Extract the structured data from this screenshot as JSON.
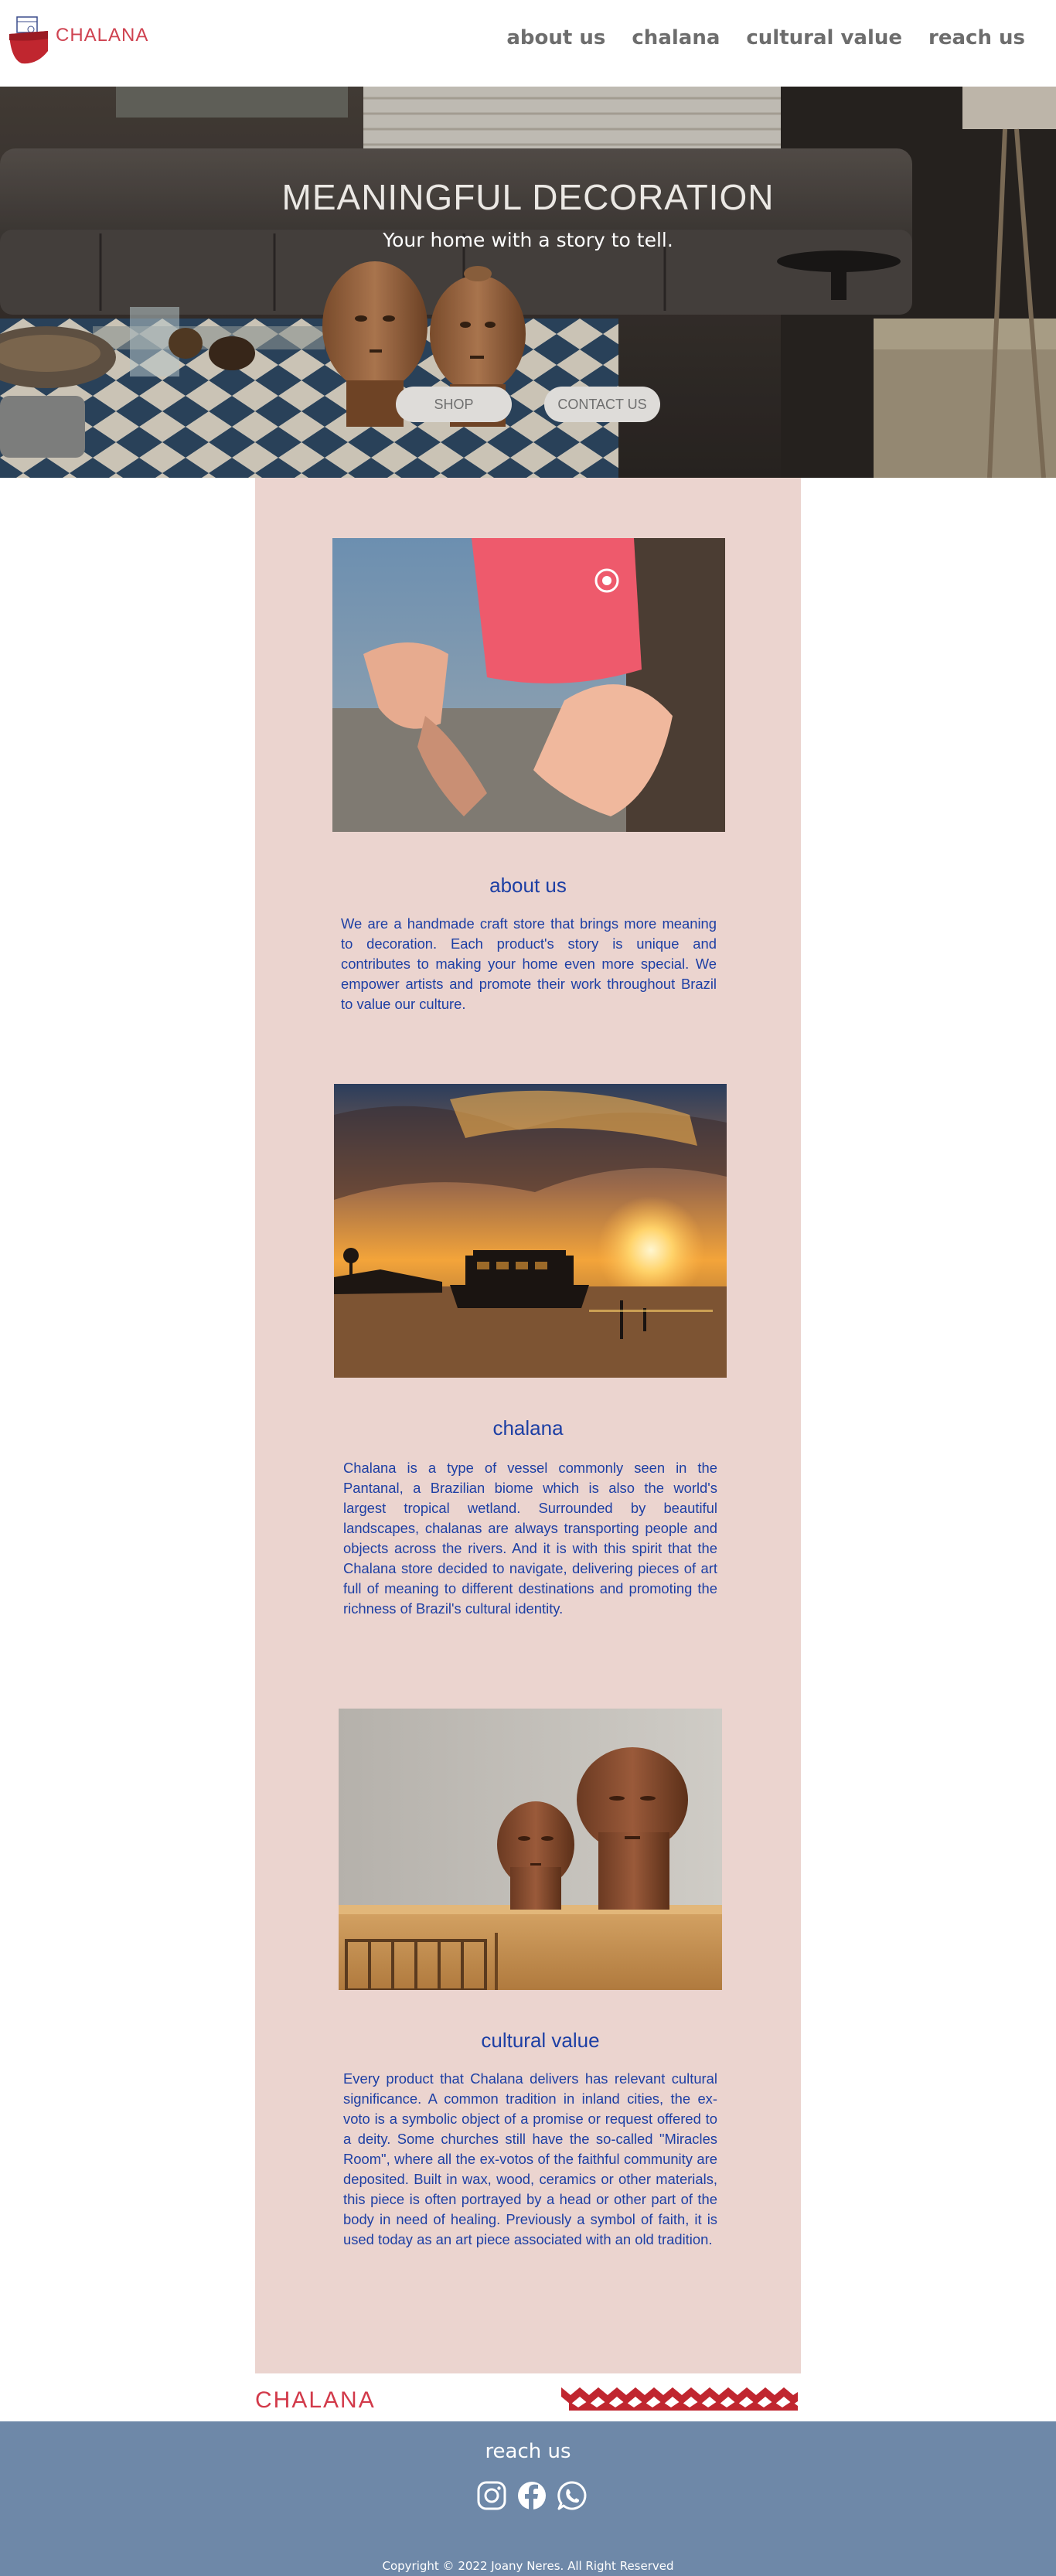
{
  "header": {
    "logo_text": "CHALANA",
    "nav": [
      "about us",
      "chalana",
      "cultural value",
      "reach us"
    ]
  },
  "hero": {
    "title": "MEANINGFUL DECORATION",
    "subtitle": "Your home with a story to tell.",
    "buttons": [
      "SHOP",
      "CONTACT US"
    ]
  },
  "sections": [
    {
      "title": "about us",
      "text": "We are a handmade craft store that brings more meaning to decoration. Each product's story is unique and contributes to making your home even more special. We empower artists and promote their work throughout Brazil to value our culture."
    },
    {
      "title": "chalana",
      "text": "Chalana is a type of vessel commonly seen in the Pantanal, a Brazilian biome which is also the world's largest tropical wetland. Surrounded by beautiful landscapes, chalanas are always transporting people and objects across the rivers. And it is with this spirit that the Chalana store decided to navigate, delivering pieces of art full of meaning to different destinations and promoting the richness of Brazil's cultural identity."
    },
    {
      "title": "cultural value",
      "text": "Every product that Chalana delivers has relevant cultural significance. A common tradition in inland cities, the ex-voto is a symbolic object of a promise or request offered to a deity. Some churches still have the so-called \"Miracles Room\", where all the ex-votos of the faithful community are deposited. Built in wax, wood, ceramics or other materials, this piece is often portrayed by a head or other part of the body in need of healing. Previously a symbol of faith, it is used today as an art piece associated with an old tradition."
    }
  ],
  "footer": {
    "strip_logo": "CHALANA",
    "title": "reach us",
    "social_icons": [
      "instagram-icon",
      "facebook-icon",
      "whatsapp-icon"
    ],
    "copyright": "Copyright © 2022 Joany Neres. All Right Reserved"
  },
  "colors": {
    "accent_red": "#d23a4a",
    "text_blue": "#1d3fa4",
    "panel_pink": "#ebd4cf",
    "footer_blue": "#6e88a8",
    "nav_gray": "#6d6d6d"
  }
}
